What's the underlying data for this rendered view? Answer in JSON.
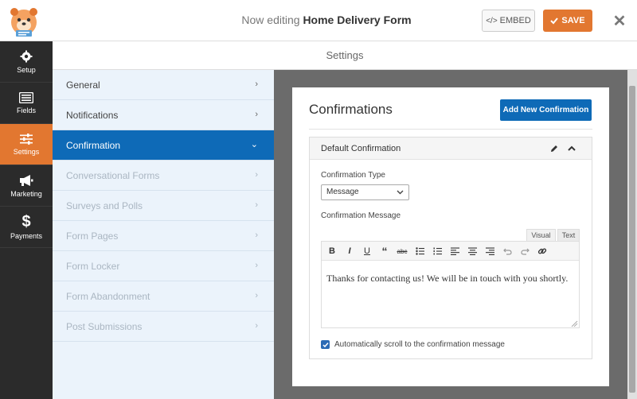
{
  "header": {
    "title_prefix": "Now editing",
    "form_name": "Home Delivery Form",
    "embed_label": "EMBED",
    "save_label": "SAVE",
    "close_label": "✕"
  },
  "sidebar": {
    "items": [
      {
        "label": "Setup",
        "icon": "gear-icon"
      },
      {
        "label": "Fields",
        "icon": "fields-icon"
      },
      {
        "label": "Settings",
        "icon": "sliders-icon"
      },
      {
        "label": "Marketing",
        "icon": "megaphone-icon"
      },
      {
        "label": "Payments",
        "icon": "dollar-icon"
      }
    ],
    "active": "Settings"
  },
  "settings_header": "Settings",
  "subnav": {
    "items": [
      {
        "label": "General",
        "state": "normal"
      },
      {
        "label": "Notifications",
        "state": "normal"
      },
      {
        "label": "Confirmation",
        "state": "active"
      },
      {
        "label": "Conversational Forms",
        "state": "disabled"
      },
      {
        "label": "Surveys and Polls",
        "state": "disabled"
      },
      {
        "label": "Form Pages",
        "state": "disabled"
      },
      {
        "label": "Form Locker",
        "state": "disabled"
      },
      {
        "label": "Form Abandonment",
        "state": "disabled"
      },
      {
        "label": "Post Submissions",
        "state": "disabled"
      }
    ]
  },
  "confirmations": {
    "title": "Confirmations",
    "add_button": "Add New Confirmation",
    "panel_title": "Default Confirmation",
    "type_label": "Confirmation Type",
    "type_value": "Message",
    "message_label": "Confirmation Message",
    "tab_visual": "Visual",
    "tab_text": "Text",
    "message_text": "Thanks for contacting us! We will be in touch with you shortly.",
    "auto_scroll_label": "Automatically scroll to the confirmation message",
    "auto_scroll_checked": true
  },
  "colors": {
    "accent_orange": "#e27730",
    "primary_blue": "#0e6ab7",
    "sidebar_dark": "#2b2b2b",
    "subnav_bg": "#ebf3fb"
  }
}
